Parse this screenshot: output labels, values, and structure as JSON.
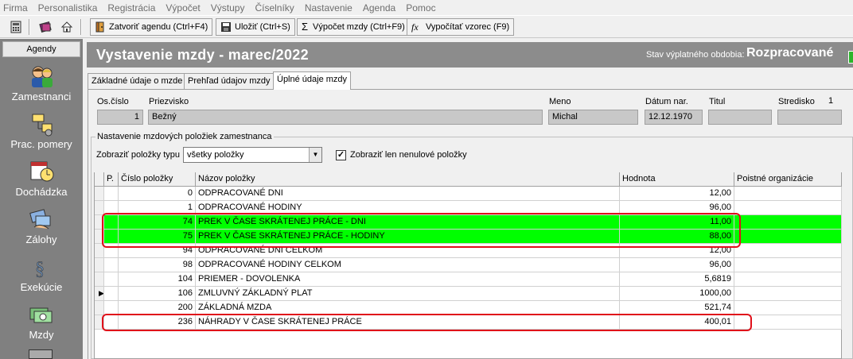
{
  "menu": [
    "Firma",
    "Personalistika",
    "Registrácia",
    "Výpočet",
    "Výstupy",
    "Číselníky",
    "Nastavenie",
    "Agenda",
    "Pomoc"
  ],
  "toolbar": {
    "close_agenda": "Zatvoriť agendu (Ctrl+F4)",
    "save": "Uložiť (Ctrl+S)",
    "calc_wage": "Výpočet mzdy (Ctrl+F9)",
    "calc_formula": "Vypočítať vzorec (F9)"
  },
  "sidebar": {
    "header": "Agendy",
    "items": [
      {
        "label": "Zamestnanci",
        "icon": "employees-icon"
      },
      {
        "label": "Prac. pomery",
        "icon": "work-relations-icon"
      },
      {
        "label": "Dochádzka",
        "icon": "attendance-icon"
      },
      {
        "label": "Zálohy",
        "icon": "advances-icon"
      },
      {
        "label": "Exekúcie",
        "icon": "execution-icon"
      },
      {
        "label": "Mzdy",
        "icon": "wages-icon"
      }
    ]
  },
  "header": {
    "title": "Vystavenie mzdy -  marec/2022",
    "state_label": "Stav výplatného obdobia:",
    "state_value": "Rozpracované"
  },
  "tabs": [
    "Základné údaje o mzde",
    "Prehľad údajov mzdy",
    "Úplné údaje mzdy"
  ],
  "employee": {
    "labels": {
      "os_cislo": "Os.číslo",
      "priezvisko": "Priezvisko",
      "meno": "Meno",
      "datum": "Dátum nar.",
      "titul": "Titul",
      "stredisko": "Stredisko"
    },
    "stredisko_num": "1",
    "os_cislo": "1",
    "priezvisko": "Bežný",
    "meno": "Michal",
    "datum": "12.12.1970",
    "titul": "",
    "stredisko": ""
  },
  "settings": {
    "group_label": "Nastavenie mzdových položiek zamestnanca",
    "type_label": "Zobraziť položky typu",
    "type_value": "všetky položky",
    "nonzero_label": "Zobraziť len nenulové položky",
    "nonzero_checked": "✓"
  },
  "grid": {
    "headers": {
      "p": "P.",
      "cislo": "Číslo položky",
      "nazov": "Názov položky",
      "hodnota": "Hodnota",
      "poistne": "Poistné organizácie"
    },
    "rows": [
      {
        "cislo": "0",
        "nazov": "ODPRACOVANÉ DNI",
        "hodnota": "12,00",
        "highlight": false,
        "current": false
      },
      {
        "cislo": "1",
        "nazov": "ODPRACOVANÉ HODINY",
        "hodnota": "96,00",
        "highlight": false,
        "current": false
      },
      {
        "cislo": "74",
        "nazov": "PREK V ČASE SKRÁTENEJ PRÁCE - DNI",
        "hodnota": "11,00",
        "highlight": true,
        "current": false
      },
      {
        "cislo": "75",
        "nazov": "PREK V ČASE SKRÁTENEJ PRÁCE - HODINY",
        "hodnota": "88,00",
        "highlight": true,
        "current": false
      },
      {
        "cislo": "94",
        "nazov": "ODPRACOVANÉ DNI CELKOM",
        "hodnota": "12,00",
        "highlight": false,
        "current": false
      },
      {
        "cislo": "98",
        "nazov": "ODPRACOVANÉ HODINY CELKOM",
        "hodnota": "96,00",
        "highlight": false,
        "current": false
      },
      {
        "cislo": "104",
        "nazov": "PRIEMER - DOVOLENKA",
        "hodnota": "5,6819",
        "highlight": false,
        "current": false
      },
      {
        "cislo": "106",
        "nazov": "ZMLUVNÝ ZÁKLADNÝ PLAT",
        "hodnota": "1000,00",
        "highlight": false,
        "current": true
      },
      {
        "cislo": "200",
        "nazov": "ZÁKLADNÁ MZDA",
        "hodnota": "521,74",
        "highlight": false,
        "current": false
      },
      {
        "cislo": "236",
        "nazov": "NÁHRADY V ČASE SKRÁTENEJ PRÁCE",
        "hodnota": "400,01",
        "highlight": false,
        "current": false
      }
    ]
  },
  "colors": {
    "highlight": "#00ff00",
    "annotation": "#e0101a",
    "header_bg": "#8c8c8c"
  }
}
